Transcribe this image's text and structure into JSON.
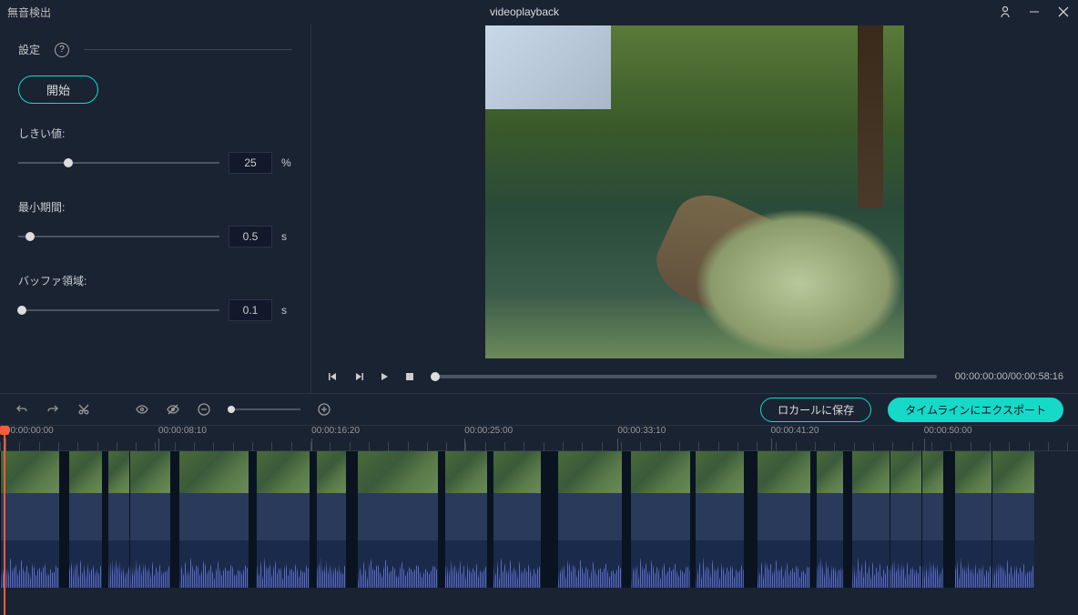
{
  "titlebar": {
    "app_title": "無音検出",
    "document_title": "videoplayback"
  },
  "sidebar": {
    "settings_label": "設定",
    "start_label": "開始",
    "params": {
      "threshold": {
        "label": "しきい値:",
        "value": "25",
        "unit": "%",
        "pos": 25
      },
      "min_duration": {
        "label": "最小期間:",
        "value": "0.5",
        "unit": "s",
        "pos": 6
      },
      "buffer": {
        "label": "バッファ領域:",
        "value": "0.1",
        "unit": "s",
        "pos": 2
      }
    }
  },
  "player": {
    "current": "00:00:00:00",
    "total": "00:00:58:16"
  },
  "toolbar": {
    "save_local": "ロカールに保存",
    "export": "タイムラインにエクスポート"
  },
  "ruler": [
    {
      "t": "00:00:00:00",
      "pos": 0.5
    },
    {
      "t": "00:00:08:10",
      "pos": 14.7
    },
    {
      "t": "00:00:16:20",
      "pos": 28.9
    },
    {
      "t": "00:00:25:00",
      "pos": 43.1
    },
    {
      "t": "00:00:33:10",
      "pos": 57.3
    },
    {
      "t": "00:00:41:20",
      "pos": 71.5
    },
    {
      "t": "00:00:50:00",
      "pos": 85.7
    }
  ],
  "clips": [
    {
      "w": 5.5
    },
    {
      "w": 0.8,
      "gap": true
    },
    {
      "w": 3.2
    },
    {
      "w": 0.5,
      "gap": true
    },
    {
      "w": 2.0
    },
    {
      "w": 3.8
    },
    {
      "w": 0.8,
      "gap": true
    },
    {
      "w": 6.5
    },
    {
      "w": 0.6,
      "gap": true
    },
    {
      "w": 5.0
    },
    {
      "w": 0.6,
      "gap": true
    },
    {
      "w": 2.8
    },
    {
      "w": 1.0,
      "gap": true
    },
    {
      "w": 7.5
    },
    {
      "w": 0.6,
      "gap": true
    },
    {
      "w": 4.0
    },
    {
      "w": 0.5,
      "gap": true
    },
    {
      "w": 4.5
    },
    {
      "w": 1.5,
      "gap": true
    },
    {
      "w": 6.0
    },
    {
      "w": 0.8,
      "gap": true
    },
    {
      "w": 5.5
    },
    {
      "w": 0.5,
      "gap": true
    },
    {
      "w": 4.5
    },
    {
      "w": 1.2,
      "gap": true
    },
    {
      "w": 5.0
    },
    {
      "w": 0.5,
      "gap": true
    },
    {
      "w": 2.5
    },
    {
      "w": 0.8,
      "gap": true
    },
    {
      "w": 3.5
    },
    {
      "w": 3.0
    },
    {
      "w": 2.0
    },
    {
      "w": 1.0,
      "gap": true
    },
    {
      "w": 3.5
    },
    {
      "w": 4.0
    }
  ]
}
